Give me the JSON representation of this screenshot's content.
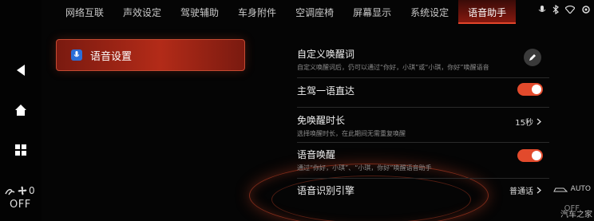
{
  "tabs": [
    "网络互联",
    "声效设定",
    "驾驶辅助",
    "车身附件",
    "空调座椅",
    "屏幕显示",
    "系统设定",
    "语音助手"
  ],
  "active_tab": "语音助手",
  "left_rail": {
    "fan_level": "0",
    "climate_status": "OFF"
  },
  "menu": {
    "selected_label": "语音设置"
  },
  "settings": {
    "custom_wake": {
      "title": "自定义唤醒词",
      "desc": "自定义唤醒词后，仍可以通过“你好，小琪”或“小琪，你好”唤醒语音"
    },
    "driver_direct": {
      "title": "主驾一语直达",
      "on": true
    },
    "wake_free": {
      "title": "免唤醒时长",
      "desc": "选择唤醒时长，在此期间无需重复唤醒",
      "value": "15秒"
    },
    "voice_wake": {
      "title": "语音唤醒",
      "desc": "通过“你好，小琪”、“小琪，你好”唤醒语音助手",
      "on": true
    },
    "recognition_engine": {
      "title": "语音识别引擎",
      "value": "普通话"
    }
  },
  "right_climate": {
    "auto_label": "AUTO",
    "off_label": "OFF"
  },
  "watermark": "汽车之家",
  "colors": {
    "accent": "#e24a2c",
    "background": "#050505"
  }
}
